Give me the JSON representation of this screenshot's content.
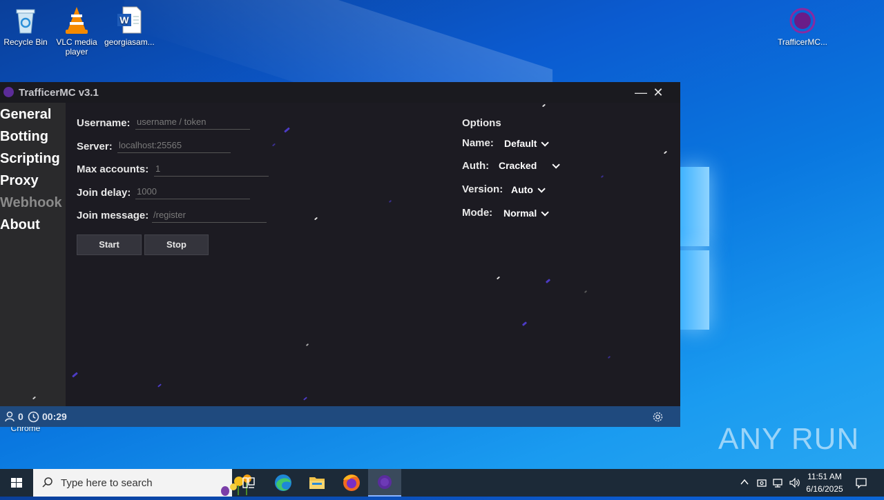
{
  "desktop": {
    "icons": [
      {
        "label": "Recycle Bin",
        "icon": "recycle-bin-icon"
      },
      {
        "label": "VLC media player",
        "icon": "vlc-icon"
      },
      {
        "label": "georgiasam...",
        "icon": "word-document-icon"
      },
      {
        "label": "TrafficerMC...",
        "icon": "trafficermc-icon"
      }
    ],
    "chrome_label": "Chrome"
  },
  "window": {
    "title": "TrafficerMC v3.1",
    "minimize": "—",
    "close": "✕"
  },
  "sidebar": {
    "items": [
      {
        "label": "General",
        "active": true
      },
      {
        "label": "Botting",
        "active": true
      },
      {
        "label": "Scripting",
        "active": true
      },
      {
        "label": "Proxy",
        "active": true
      },
      {
        "label": "Webhook",
        "active": false
      },
      {
        "label": "About",
        "active": true
      }
    ]
  },
  "form": {
    "username": {
      "label": "Username:",
      "placeholder": "username / token"
    },
    "server": {
      "label": "Server:",
      "placeholder": "localhost:25565"
    },
    "max_accounts": {
      "label": "Max accounts:",
      "placeholder": "1"
    },
    "join_delay": {
      "label": "Join delay:",
      "placeholder": "1000"
    },
    "join_message": {
      "label": "Join message:",
      "placeholder": "/register"
    },
    "start_label": "Start",
    "stop_label": "Stop"
  },
  "options": {
    "heading": "Options",
    "name": {
      "label": "Name:",
      "value": "Default"
    },
    "auth": {
      "label": "Auth:",
      "value": "Cracked"
    },
    "version": {
      "label": "Version:",
      "value": "Auto"
    },
    "mode": {
      "label": "Mode:",
      "value": "Normal"
    }
  },
  "status": {
    "bot_count": "0",
    "timer": "00:29"
  },
  "taskbar": {
    "search_placeholder": "Type here to search",
    "time": "11:51 AM",
    "date": "6/16/2025"
  },
  "watermark": "ANY RUN",
  "colors": {
    "accent": "#5c2c99",
    "status_bar": "#1f4a7e",
    "app_bg": "#1c1b22"
  }
}
